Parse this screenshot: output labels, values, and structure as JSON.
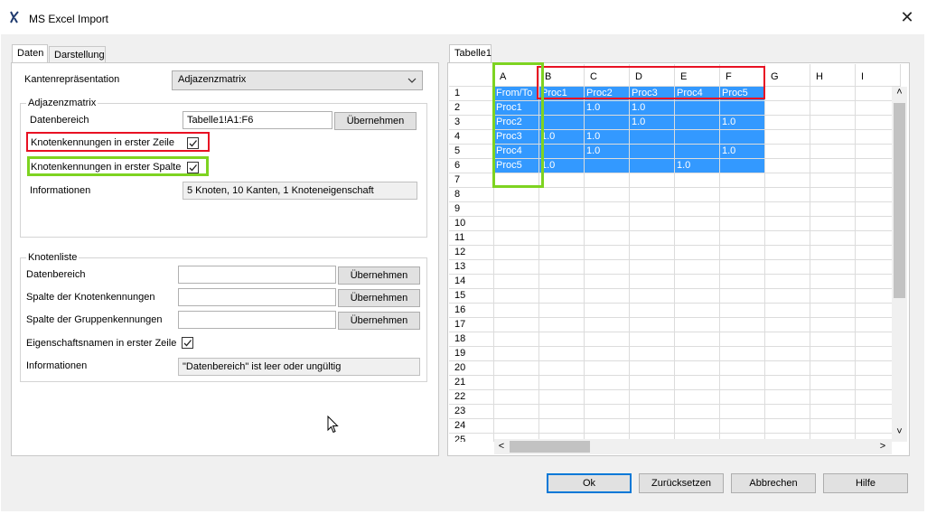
{
  "window": {
    "title": "MS Excel Import",
    "close_glyph": "✕"
  },
  "tabs": [
    {
      "label": "Daten"
    },
    {
      "label": "Darstellung"
    }
  ],
  "kanten": {
    "label": "Kantenrepräsentation",
    "value": "Adjazenzmatrix"
  },
  "adj": {
    "group_title": "Adjazenzmatrix",
    "datenbereich_label": "Datenbereich",
    "datenbereich_value": "Tabelle1!A1:F6",
    "apply_label": "Übernehmen",
    "first_row_label": "Knotenkennungen in erster Zeile",
    "first_row_checked": true,
    "first_col_label": "Knotenkennungen in erster Spalte",
    "first_col_checked": true,
    "info_label": "Informationen",
    "info_value": "5 Knoten, 10 Kanten, 1 Knoteneigenschaft"
  },
  "knoten": {
    "group_title": "Knotenliste",
    "datenbereich_label": "Datenbereich",
    "spalte_knoten_label": "Spalte der Knotenkennungen",
    "spalte_gruppen_label": "Spalte der Gruppenkennungen",
    "apply_label": "Übernehmen",
    "eigenschaft_label": "Eigenschaftsnamen in erster Zeile",
    "eigenschaft_checked": true,
    "info_label": "Informationen",
    "info_value": "\"Datenbereich\" ist leer oder ungültig"
  },
  "sheet": {
    "tab_label": "Tabelle1",
    "columns": [
      "A",
      "B",
      "C",
      "D",
      "E",
      "F",
      "G",
      "H",
      "I"
    ],
    "row_numbers": [
      "1",
      "2",
      "3",
      "4",
      "5",
      "6",
      "7",
      "8",
      "9",
      "10",
      "11",
      "12",
      "13",
      "14",
      "15",
      "16",
      "17",
      "18",
      "19",
      "20",
      "21",
      "22",
      "23",
      "24",
      "25"
    ],
    "cells": [
      [
        "From/To",
        "Proc1",
        "Proc2",
        "Proc3",
        "Proc4",
        "Proc5"
      ],
      [
        "Proc1",
        "",
        "1.0",
        "1.0",
        "",
        ""
      ],
      [
        "Proc2",
        "",
        "",
        "1.0",
        "",
        "1.0"
      ],
      [
        "Proc3",
        "1.0",
        "1.0",
        "",
        "",
        ""
      ],
      [
        "Proc4",
        "",
        "1.0",
        "",
        "",
        "1.0"
      ],
      [
        "Proc5",
        "1.0",
        "",
        "",
        "1.0",
        ""
      ]
    ],
    "scroll_up": "˄",
    "scroll_down": "˅",
    "scroll_left": "<",
    "scroll_right": ">"
  },
  "buttons": {
    "ok": "Ok",
    "reset": "Zurücksetzen",
    "cancel": "Abbrechen",
    "help": "Hilfe"
  },
  "colors": {
    "selection": "#3399ff",
    "highlight_red": "#e81123",
    "highlight_green": "#7ed321",
    "default_button_border": "#0078d7"
  }
}
